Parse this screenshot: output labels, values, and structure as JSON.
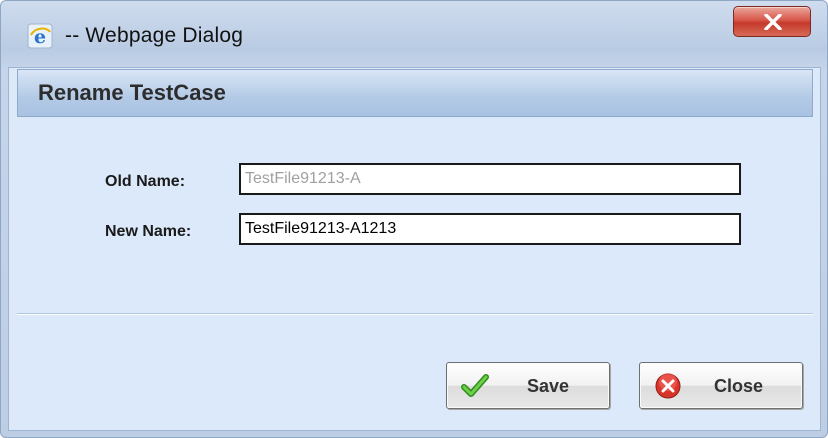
{
  "window": {
    "title": "-- Webpage Dialog",
    "icon": "ie-icon",
    "close_icon": "close-x-icon"
  },
  "dialog": {
    "heading": "Rename TestCase"
  },
  "form": {
    "old_name_label": "Old Name:",
    "old_name_value": "TestFile91213-A",
    "new_name_label": "New Name:",
    "new_name_value": "TestFile91213-A1213"
  },
  "buttons": {
    "save_label": "Save",
    "save_icon": "checkmark-icon",
    "close_label": "Close",
    "close_icon": "red-x-icon"
  },
  "colors": {
    "close_button": "#d8564a",
    "header_band": "#b3cae6",
    "client_bg": "#dce9fa",
    "save_check": "#4caf2e",
    "close_circle": "#d9342b"
  }
}
